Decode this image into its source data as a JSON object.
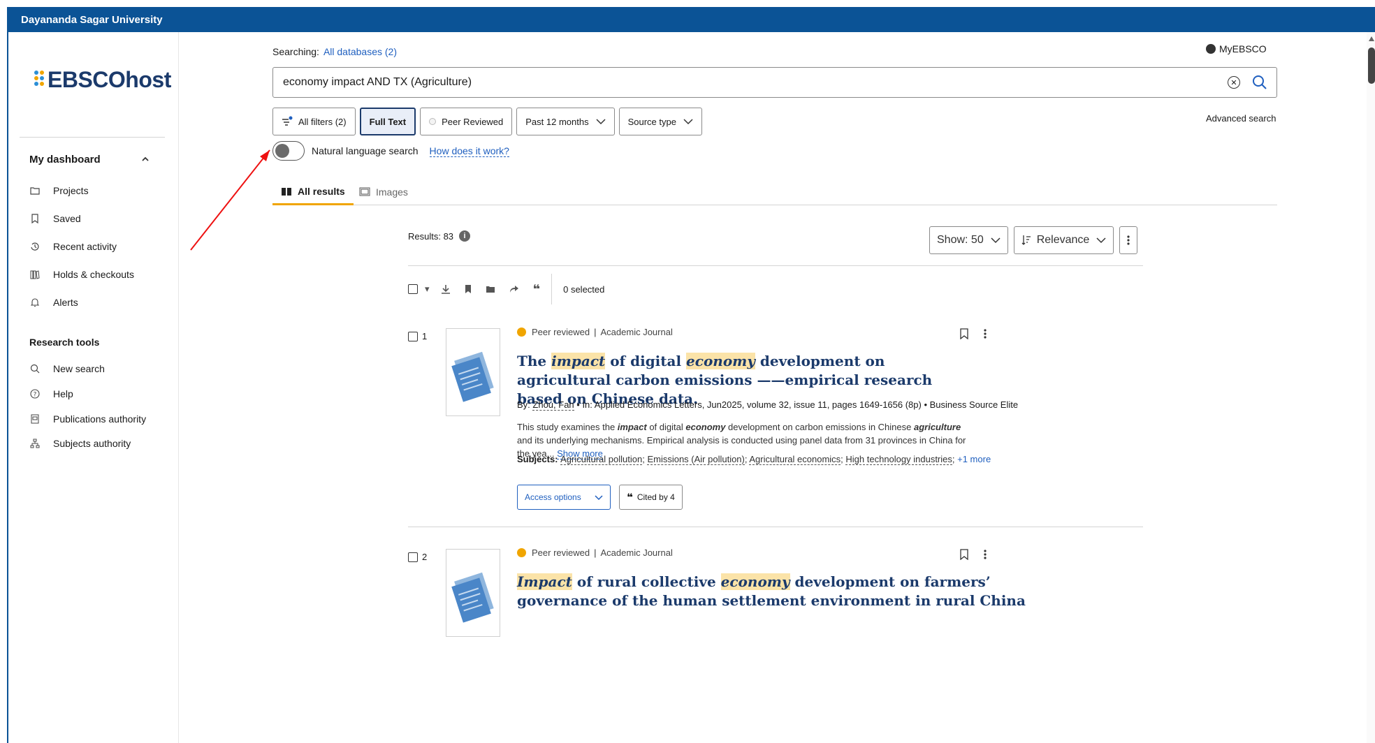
{
  "topbar": {
    "title": "Dayananda Sagar University"
  },
  "sidebar": {
    "logo": "EBSCOhost",
    "dashboard_heading": "My dashboard",
    "dashboard_items": [
      {
        "label": "Projects",
        "icon": "folder-icon"
      },
      {
        "label": "Saved",
        "icon": "bookmark-icon"
      },
      {
        "label": "Recent activity",
        "icon": "history-icon"
      },
      {
        "label": "Holds & checkouts",
        "icon": "books-icon"
      },
      {
        "label": "Alerts",
        "icon": "bell-icon"
      }
    ],
    "tools_heading": "Research tools",
    "tools_items": [
      {
        "label": "New search",
        "icon": "search-icon"
      },
      {
        "label": "Help",
        "icon": "help-icon"
      },
      {
        "label": "Publications authority",
        "icon": "publication-icon"
      },
      {
        "label": "Subjects authority",
        "icon": "hierarchy-icon"
      }
    ]
  },
  "header": {
    "searching_label": "Searching:",
    "searching_link": "All databases (2)",
    "myebsco": "MyEBSCO",
    "query": "economy impact AND TX (Agriculture)",
    "advanced": "Advanced search"
  },
  "filters": {
    "all_filters": "All filters (2)",
    "full_text": "Full Text",
    "peer_reviewed": "Peer Reviewed",
    "past": "Past 12 months",
    "source": "Source type"
  },
  "nl": {
    "label": "Natural language search",
    "how": "How does it work?"
  },
  "tabs": {
    "all": "All results",
    "images": "Images"
  },
  "results": {
    "count": "Results: 83",
    "show": "Show: 50",
    "sort": "Relevance",
    "selected": "0 selected"
  },
  "items": [
    {
      "num": "1",
      "meta_type": "Peer reviewed",
      "meta_source": "Academic Journal",
      "title_parts": [
        "The ",
        "impact",
        " of digital ",
        "economy",
        " development on agricultural carbon emissions ——empirical research based on Chinese data."
      ],
      "by_label": "By: ",
      "author": "Zhou, Fan",
      "byline_rest": " • In: Applied Economics Letters, Jun2025, volume 32, issue 11, pages 1649-1656 (8p) • Business Source Elite",
      "abstract_a": "This study examines the ",
      "abstract_b1": "impact",
      "abstract_c": " of digital ",
      "abstract_b2": "economy",
      "abstract_d": " development on carbon emissions in Chinese ",
      "abstract_b3": "agriculture",
      "abstract_e": " and its underlying mechanisms. Empirical analysis is conducted using panel data from 31 provinces in China for the yea...",
      "show_more": "Show more",
      "subjects_label": "Subjects: ",
      "subjects": [
        "Agricultural pollution",
        "Emissions (Air pollution)",
        "Agricultural economics",
        "High technology industries"
      ],
      "subjects_more": "+1 more",
      "access": "Access options",
      "cited": "Cited by 4"
    },
    {
      "num": "2",
      "meta_type": "Peer reviewed",
      "meta_source": "Academic Journal",
      "title_parts": [
        "Impact",
        " of rural collective ",
        "economy",
        " development on farmers’ governance of the human settlement environment in rural China"
      ]
    }
  ]
}
